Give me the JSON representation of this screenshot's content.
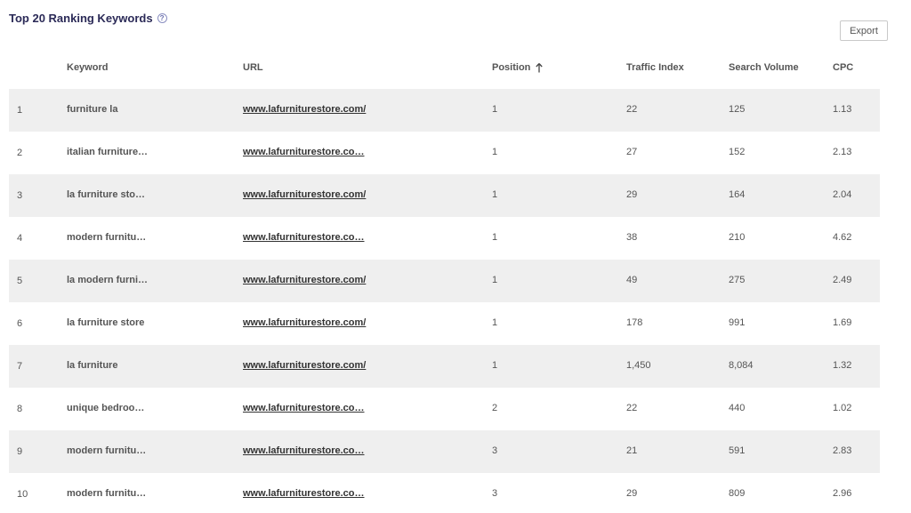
{
  "header": {
    "title": "Top 20 Ranking Keywords",
    "help_icon": "?",
    "export_label": "Export"
  },
  "table": {
    "columns": {
      "keyword": "Keyword",
      "url": "URL",
      "position": "Position",
      "traffic_index": "Traffic Index",
      "search_volume": "Search Volume",
      "cpc": "CPC"
    },
    "sort": {
      "column": "position",
      "direction": "ascending",
      "icon": "arrow-up-icon"
    },
    "rows": [
      {
        "num": "1",
        "keyword": "furniture la",
        "url": "www.lafurniturestore.com/",
        "position": "1",
        "traffic_index": "22",
        "search_volume": "125",
        "cpc": "1.13"
      },
      {
        "num": "2",
        "keyword": "italian furniture…",
        "url": "www.lafurniturestore.co…",
        "position": "1",
        "traffic_index": "27",
        "search_volume": "152",
        "cpc": "2.13"
      },
      {
        "num": "3",
        "keyword": "la furniture sto…",
        "url": "www.lafurniturestore.com/",
        "position": "1",
        "traffic_index": "29",
        "search_volume": "164",
        "cpc": "2.04"
      },
      {
        "num": "4",
        "keyword": "modern furnitu…",
        "url": "www.lafurniturestore.co…",
        "position": "1",
        "traffic_index": "38",
        "search_volume": "210",
        "cpc": "4.62"
      },
      {
        "num": "5",
        "keyword": "la modern furni…",
        "url": "www.lafurniturestore.com/",
        "position": "1",
        "traffic_index": "49",
        "search_volume": "275",
        "cpc": "2.49"
      },
      {
        "num": "6",
        "keyword": "la furniture store",
        "url": "www.lafurniturestore.com/",
        "position": "1",
        "traffic_index": "178",
        "search_volume": "991",
        "cpc": "1.69"
      },
      {
        "num": "7",
        "keyword": "la furniture",
        "url": "www.lafurniturestore.com/",
        "position": "1",
        "traffic_index": "1,450",
        "search_volume": "8,084",
        "cpc": "1.32"
      },
      {
        "num": "8",
        "keyword": "unique bedroo…",
        "url": "www.lafurniturestore.co…",
        "position": "2",
        "traffic_index": "22",
        "search_volume": "440",
        "cpc": "1.02"
      },
      {
        "num": "9",
        "keyword": "modern furnitu…",
        "url": "www.lafurniturestore.co…",
        "position": "3",
        "traffic_index": "21",
        "search_volume": "591",
        "cpc": "2.83"
      },
      {
        "num": "10",
        "keyword": "modern furnitu…",
        "url": "www.lafurniturestore.co…",
        "position": "3",
        "traffic_index": "29",
        "search_volume": "809",
        "cpc": "2.96"
      }
    ]
  },
  "colors": {
    "title": "#2b2a57",
    "row_shade": "#efefef",
    "text": "#555555"
  }
}
